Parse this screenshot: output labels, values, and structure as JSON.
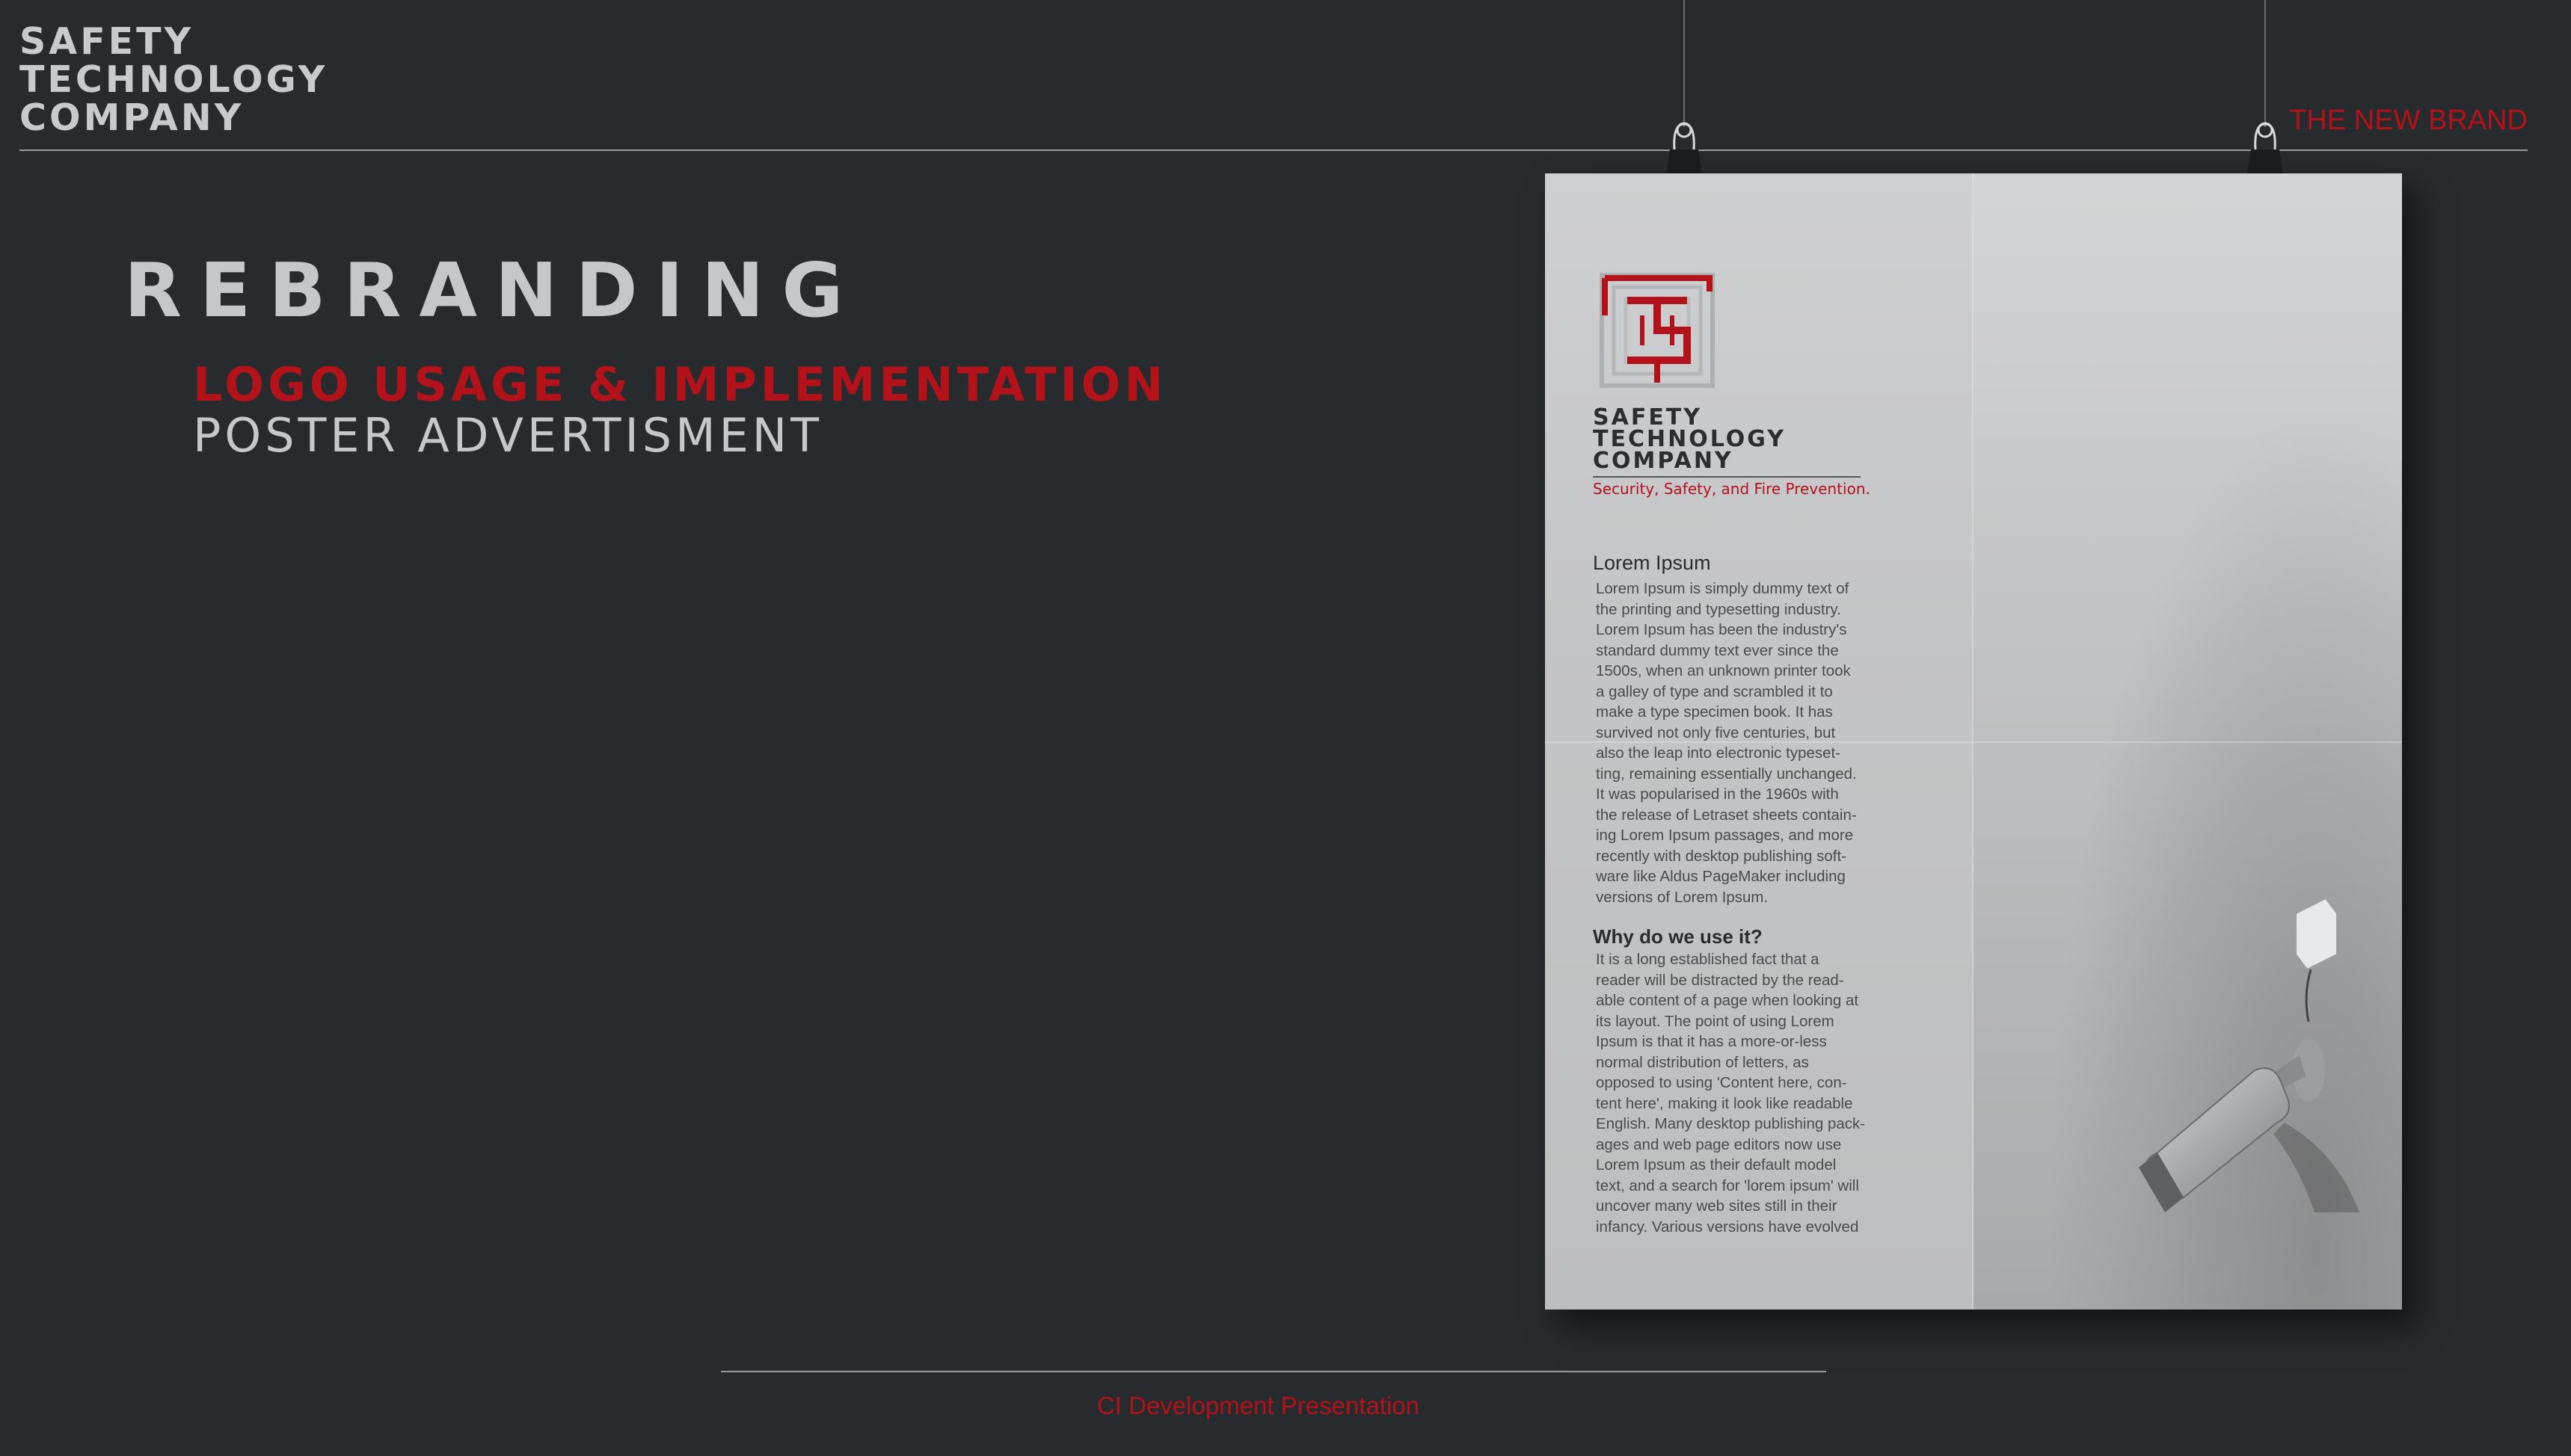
{
  "header": {
    "company_lines": [
      "SAFETY",
      "TECHNOLOGY",
      "COMPANY"
    ],
    "right_label": "THE NEW BRAND"
  },
  "main": {
    "title": "REBRANDING",
    "subtitle_red": "LOGO USAGE & IMPLEMENTATION",
    "subtitle_grey": "POSTER ADVERTISMENT"
  },
  "poster": {
    "logo_icon": "sts-maze-logo-icon",
    "company_lines": [
      "SAFETY",
      "TECHNOLOGY",
      "COMPANY"
    ],
    "tagline": "Security, Safety, and Fire Prevention.",
    "section1_heading": "Lorem Ipsum",
    "section1_lines": [
      "Lorem Ipsum is simply dummy text of",
      "the printing and typesetting industry.",
      "Lorem Ipsum has been the industry's",
      "standard dummy text ever since the",
      "1500s, when an unknown printer took",
      "a galley of type and scrambled it to",
      "make a type specimen book. It has",
      "survived not only five centuries, but",
      "also the leap into electronic typeset-",
      "ting, remaining essentially unchanged.",
      "It was popularised in the 1960s with",
      "the release of Letraset sheets contain-",
      "ing Lorem Ipsum passages, and more",
      "recently with desktop publishing soft-",
      "ware like Aldus PageMaker including",
      "versions of Lorem Ipsum."
    ],
    "section2_heading": "Why do we use it?",
    "section2_lines": [
      "It is a long established fact that a",
      "reader will be distracted by the read-",
      "able content of a page when looking at",
      "its layout. The point of using Lorem",
      "Ipsum is that it has a more-or-less",
      "normal distribution of letters, as",
      "opposed to using 'Content here, con-",
      "tent here', making it look like readable",
      "English. Many desktop publishing pack-",
      "ages and web page editors now use",
      "Lorem Ipsum as their default model",
      "text, and a search for 'lorem ipsum' will",
      "uncover many web sites still in their",
      "infancy. Various versions have evolved"
    ],
    "photo_icon": "security-camera-icon"
  },
  "footer": {
    "label": "CI Development Presentation"
  },
  "colors": {
    "background": "#282b2d",
    "accent_red": "#b3121a",
    "light_grey": "#c6c7c8"
  }
}
